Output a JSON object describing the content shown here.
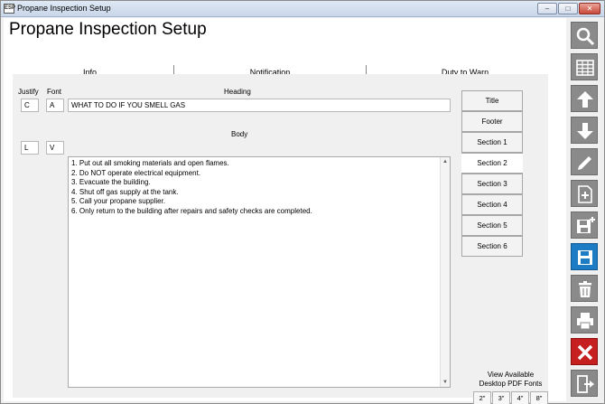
{
  "window": {
    "title": "Propane Inspection Setup",
    "app_icon_text": "ESP",
    "controls": {
      "minimize": "–",
      "maximize": "□",
      "close": "✕"
    }
  },
  "page": {
    "title": "Propane Inspection Setup"
  },
  "tabs": [
    {
      "label": "Info"
    },
    {
      "label": "Notification"
    },
    {
      "label": "Duty to Warn"
    }
  ],
  "form": {
    "justify_label": "Justify",
    "font_label": "Font",
    "heading_label": "Heading",
    "body_label": "Body",
    "heading": {
      "justify": "C",
      "font": "A",
      "text": "WHAT TO DO IF YOU SMELL GAS"
    },
    "body": {
      "justify": "L",
      "font": "V",
      "lines": [
        "1. Put out all smoking materials and open flames.",
        "2. Do NOT operate electrical equipment.",
        "3. Evacuate the building.",
        "4. Shut off gas supply at the tank.",
        "5. Call your propane supplier.",
        "6. Only return to the building after repairs and safety checks are completed."
      ]
    }
  },
  "section_tabs": [
    {
      "label": "Title"
    },
    {
      "label": "Footer"
    },
    {
      "label": "Section 1"
    },
    {
      "label": "Section 2"
    },
    {
      "label": "Section 3"
    },
    {
      "label": "Section 4"
    },
    {
      "label": "Section 5"
    },
    {
      "label": "Section 6"
    }
  ],
  "active_section": "Section 2",
  "pdf_fonts": {
    "label_line1": "View Available",
    "label_line2": "Desktop PDF Fonts",
    "sizes": [
      "2\"",
      "3\"",
      "4\"",
      "8\""
    ]
  },
  "toolbar": {
    "buttons": [
      "search-icon",
      "grid-icon",
      "arrow-up-icon",
      "arrow-down-icon",
      "pencil-icon",
      "add-document-icon",
      "save-new-icon",
      "save-icon",
      "delete-icon",
      "print-icon",
      "close-icon",
      "exit-icon"
    ]
  },
  "colors": {
    "toolbar_gray": "#8a8a8a",
    "save_blue": "#1e7cc4",
    "close_red": "#c51f1f"
  }
}
